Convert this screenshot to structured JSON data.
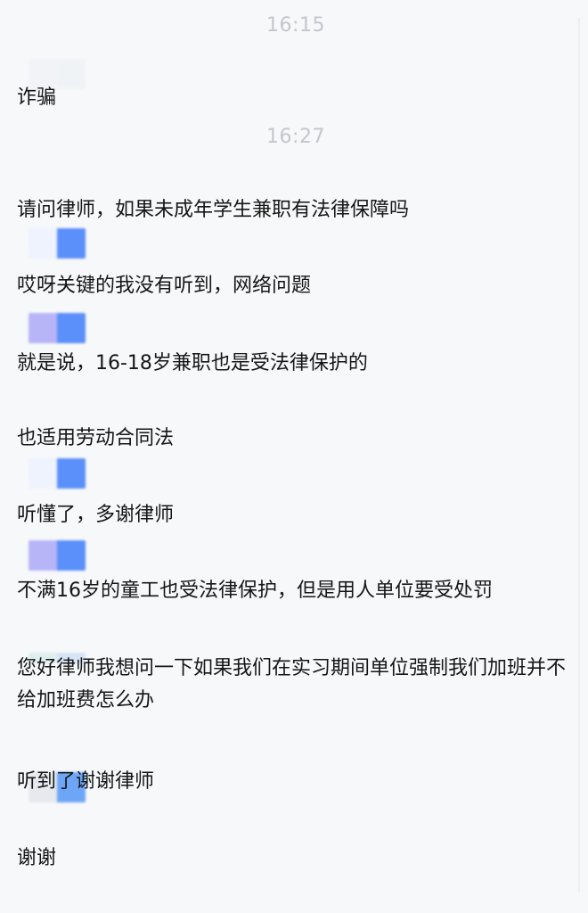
{
  "timestamps": [
    "16:15",
    "16:27"
  ],
  "messages": [
    "诈骗",
    "请问律师，如果未成年学生兼职有法律保障吗",
    "哎呀关键的我没有听到，网络问题",
    "就是说，16-18岁兼职也是受法律保护的",
    "也适用劳动合同法",
    "听懂了，多谢律师",
    "不满16岁的童工也受法律保护，但是用人单位要受处罚",
    "您好律师我想问一下如果我们在实习期间单位强制我们加班并不给加班费怎么办",
    "听到了谢谢律师",
    "谢谢"
  ],
  "colors": {
    "background": "#f7f8fa",
    "message_text": "#161616",
    "timestamp_text": "#c3c6cc",
    "avatar_blue": "#5b8ff9",
    "avatar_lavender": "#b7b4f7",
    "avatar_light_blue": "#e6eefc"
  }
}
